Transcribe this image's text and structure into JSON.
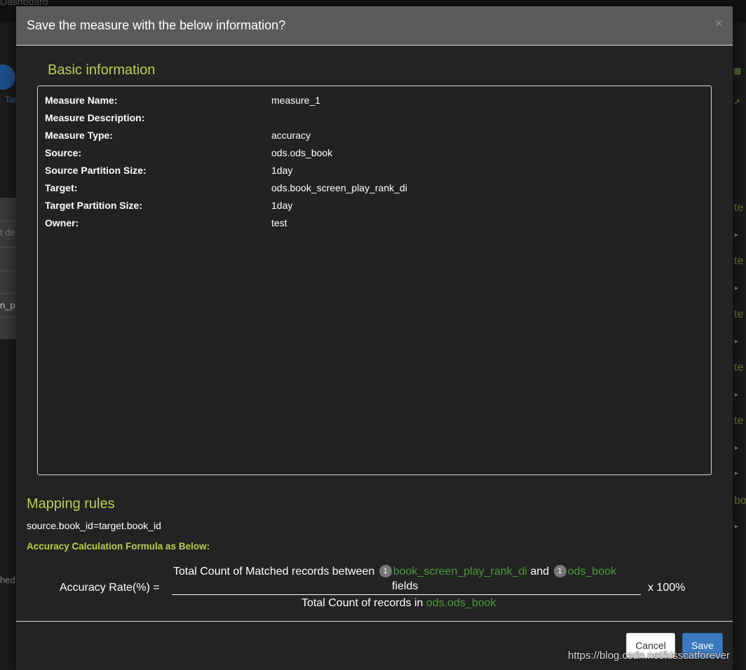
{
  "background": {
    "dashboard_label": "Dashboard",
    "left_text_1": "t de",
    "left_text_2": "n_p",
    "left_text_3": "hed",
    "left_link": "· Tar",
    "right_labels": [
      "te",
      "te",
      "te",
      "te",
      "te",
      "bo"
    ]
  },
  "modal": {
    "title": "Save the measure with the below information?",
    "close_label": "×"
  },
  "basic_info": {
    "section_title": "Basic information",
    "rows": [
      {
        "label": "Measure Name:",
        "value": "measure_1"
      },
      {
        "label": "Measure Description:",
        "value": ""
      },
      {
        "label": "Measure Type:",
        "value": "accuracy"
      },
      {
        "label": "Source:",
        "value": "ods.ods_book"
      },
      {
        "label": "Source Partition Size:",
        "value": "1day"
      },
      {
        "label": "Target:",
        "value": "ods.book_screen_play_rank_di"
      },
      {
        "label": "Target Partition Size:",
        "value": "1day"
      },
      {
        "label": "Owner:",
        "value": "test"
      }
    ]
  },
  "mapping": {
    "section_title": "Mapping rules",
    "rule": "source.book_id=target.book_id",
    "formula_title": "Accuracy Calculation Formula as Below:"
  },
  "formula": {
    "rate_label": "Accuracy Rate(%) =",
    "numerator_prefix": "Total Count of Matched records between",
    "badge_1": "1",
    "target_name": "book_screen_play_rank_di",
    "and": "and",
    "badge_2": "1",
    "source_name": "ods_book",
    "numerator_suffix": "fields",
    "denominator_prefix": "Total Count of records in",
    "denominator_source": "ods.ods_book",
    "multiplier": "x 100%"
  },
  "footer": {
    "cancel_label": "Cancel",
    "save_label": "Save"
  },
  "watermark": "https://blog.csdn.net/kisscatforever",
  "colors": {
    "accent_green": "#b8d24a",
    "link_green": "#4d9a3a",
    "primary_blue": "#3a79bd"
  }
}
